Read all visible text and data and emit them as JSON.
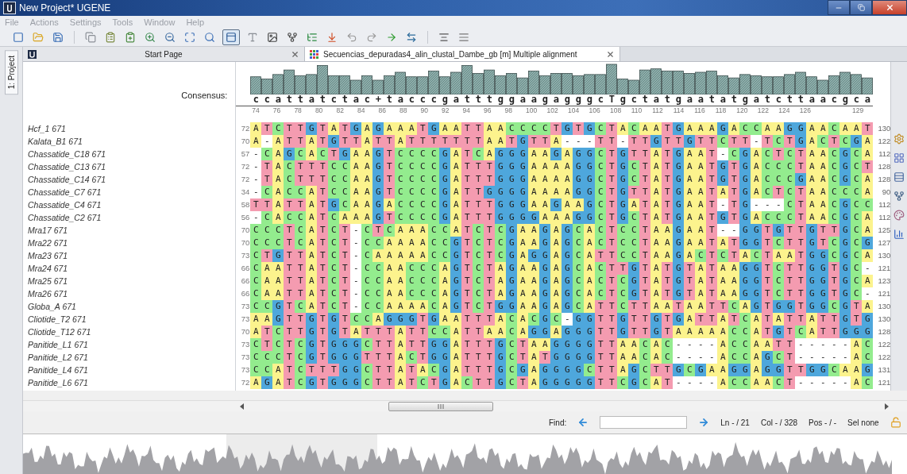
{
  "window": {
    "title": "New Project* UGENE"
  },
  "menu": [
    "File",
    "Actions",
    "Settings",
    "Tools",
    "Window",
    "Help"
  ],
  "side_tab": {
    "label": "1: Project"
  },
  "tabs": [
    {
      "label": "Start Page",
      "selected": false
    },
    {
      "label": "Secuencias_depuradas4_alin_clustal_Dambe_gb [m] Multiple alignment",
      "selected": true
    }
  ],
  "alignment": {
    "consensus_label": "Consensus:",
    "consensus": "ccattatctac+tacccgatttggaagagggcTgctatgaatatgatcttaacgca",
    "ruler": [
      "74",
      "76",
      "78",
      "80",
      "82",
      "84",
      "86",
      "88",
      "90",
      "92",
      "94",
      "96",
      "98",
      "100",
      "102",
      "104",
      "106",
      "108",
      "110",
      "112",
      "114",
      "116",
      "118",
      "120",
      "122",
      "124",
      "126",
      "129"
    ],
    "rows": [
      {
        "name": "Hcf_1 671",
        "start": "72",
        "sequence": "ATCTTGTATGAGAAATGAATTAACCCCTGTGCTACAATGAAAGACCAAGGAACAAT",
        "end": "130"
      },
      {
        "name": "Kalata_B1 671",
        "start": "70",
        "sequence": "A-ATTATGTTATTATTTTTTTAATGTTA---TT-TTGTTGTTCTT-TCTGACTCGA",
        "end": "122"
      },
      {
        "name": "Chassatide_C18 671",
        "start": "57",
        "sequence": "-CAGCACTGAAGTCCCCGATCAGGGAAGAGGCTGTTATGAAT-CGACTCTAACGCA",
        "end": "112"
      },
      {
        "name": "Chassatide_C13 671",
        "start": "72",
        "sequence": "-TACTTTCCAAGTCCCCGATTTGGGAAAAGGCTGCTATGAATGTGACCCTAACGCT",
        "end": "128"
      },
      {
        "name": "Chassatide_C14 671",
        "start": "72",
        "sequence": "-TACTTTCCAAGTCCCCGATTTGGGAAAAGGCTGCTATGAATGTGACCCGAACGCA",
        "end": "128"
      },
      {
        "name": "Chassatide_C7 671",
        "start": "34",
        "sequence": "-CACCATCCAAGTCCCCGATTGGGGAAAAGGCTGTTATGAATATGACTCTAACCCA",
        "end": "90"
      },
      {
        "name": "Chassatide_C4 671",
        "start": "58",
        "sequence": "TTATTATGCAAGACCCCGATTTGGGAAGAAGCTGATATGAAT-TG---CTAACGCC",
        "end": "112"
      },
      {
        "name": "Chassatide_C2 671",
        "start": "56",
        "sequence": "-CACCATCAAAGTCCCCGATTTGGGGAAAGGCTGCTATGAATGTGACCCTAACGCA",
        "end": "112"
      },
      {
        "name": "Mra17 671",
        "start": "70",
        "sequence": "CCCTCATCT-CTCAAACCATCTCGAAGAGCACTCCTAAGAAT--GGTGTTGTTGCA",
        "end": "125"
      },
      {
        "name": "Mra22 671",
        "start": "70",
        "sequence": "CCCTCATCT-CCAAAACCGTCTCGAAGAGCACTCCTAAGAATATGGTCTTGTCGCG",
        "end": "127"
      },
      {
        "name": "Mra23 671",
        "start": "73",
        "sequence": "CTGTTATCT-CAAAAACCGTCTCGAGGAGCATTCCTAAGACTCTACTAATGGCGCA",
        "end": "130"
      },
      {
        "name": "Mra24 671",
        "start": "66",
        "sequence": "CAATTATCT-CCAACCCAGTCTAGAAGAGCACTTGTATGTATAAGGTCTTGGTGC-",
        "end": "121"
      },
      {
        "name": "Mra25 671",
        "start": "66",
        "sequence": "CAATTATCT-CCAACCCAGTCTAGAAGAGCACTCGTATGTATAAGGTCTTGGTGCA",
        "end": "123"
      },
      {
        "name": "Mra26 671",
        "start": "66",
        "sequence": "CAATTATCT-CCAACCCAGTCTAGAAGAGCACTCGTATGTATAAGGTCTTGGTGC-",
        "end": "121"
      },
      {
        "name": "Globa_A 671",
        "start": "73",
        "sequence": "CCGTCATCT-CCAAAACAGTCTGGAAGAGCATTCTTAATAATTCAGTGGTGGCGTA",
        "end": "130"
      },
      {
        "name": "Cliotide_T2 671",
        "start": "73",
        "sequence": "AAGTTGTGTCCAGGGTGAATTTACACGC-GGTTGTTGTGATTATCATATTATTGTG",
        "end": "130"
      },
      {
        "name": "Cliotide_T12 671",
        "start": "70",
        "sequence": "ATCTTGTGTATTTATTCCATTAACAGGAGGGTTGTTGTAAAAACCATGTCATTGGG",
        "end": "128"
      },
      {
        "name": "Panitide_L1 671",
        "start": "73",
        "sequence": "CTCTCGTGGGCTTATTGGATTTGCTAAGGGGTTAACAC----ACCAATT-----AC",
        "end": "122"
      },
      {
        "name": "Panitide_L2 671",
        "start": "73",
        "sequence": "CCCTCGTGGGTTTACTGGATTTGCTATGGGGTTAACAC----ACCAGCT-----AC",
        "end": "122"
      },
      {
        "name": "Panitide_L4 671",
        "start": "73",
        "sequence": "CCATCTTTGGCTTATACGATTTGCGAGGGGCTTAGCTTGCGAAGGAGGTTGGCAAG",
        "end": "131"
      },
      {
        "name": "Panitide_L6 671",
        "start": "72",
        "sequence": "AGATCGTGGGCTTATCTGACTTGCTAGGGGGTTCGCAT----ACCAACT-----AC",
        "end": "121"
      }
    ]
  },
  "find_bar": {
    "label": "Find:",
    "ln": "Ln - / 21",
    "col": "Col - / 328",
    "pos": "Pos - / -",
    "sel": "Sel none"
  }
}
